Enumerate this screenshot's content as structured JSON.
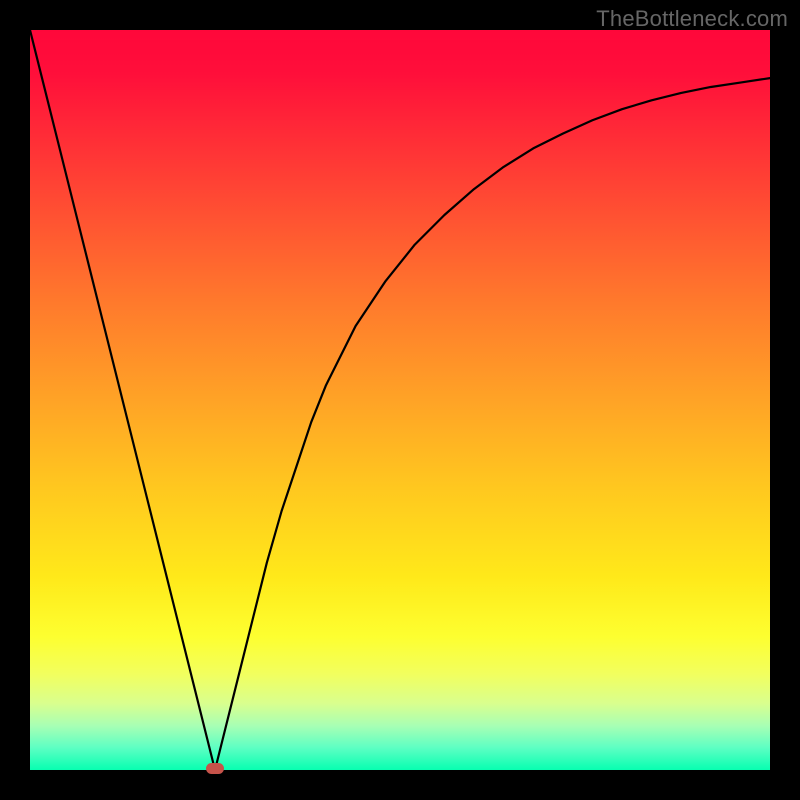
{
  "attribution": "TheBottleneck.com",
  "colors": {
    "frame": "#000000",
    "gradient_top": "#ff073a",
    "gradient_bottom": "#07ffb1",
    "curve": "#000000",
    "marker": "#c6534a"
  },
  "chart_data": {
    "type": "line",
    "title": "",
    "xlabel": "",
    "ylabel": "",
    "xlim": [
      0,
      100
    ],
    "ylim": [
      0,
      100
    ],
    "grid": false,
    "legend": false,
    "x": [
      0,
      2,
      4,
      6,
      8,
      10,
      12,
      14,
      16,
      18,
      20,
      22,
      24,
      25,
      26,
      28,
      30,
      32,
      34,
      36,
      38,
      40,
      44,
      48,
      52,
      56,
      60,
      64,
      68,
      72,
      76,
      80,
      84,
      88,
      92,
      96,
      100
    ],
    "y": [
      100,
      92,
      84,
      76,
      68,
      60,
      52,
      44,
      36,
      28,
      20,
      12,
      4,
      0,
      4,
      12,
      20,
      28,
      35,
      41,
      47,
      52,
      60,
      66,
      71,
      75,
      78.5,
      81.5,
      84,
      86,
      87.8,
      89.3,
      90.5,
      91.5,
      92.3,
      92.9,
      93.5
    ],
    "marker": {
      "x": 25,
      "y": 0
    },
    "annotations": []
  }
}
